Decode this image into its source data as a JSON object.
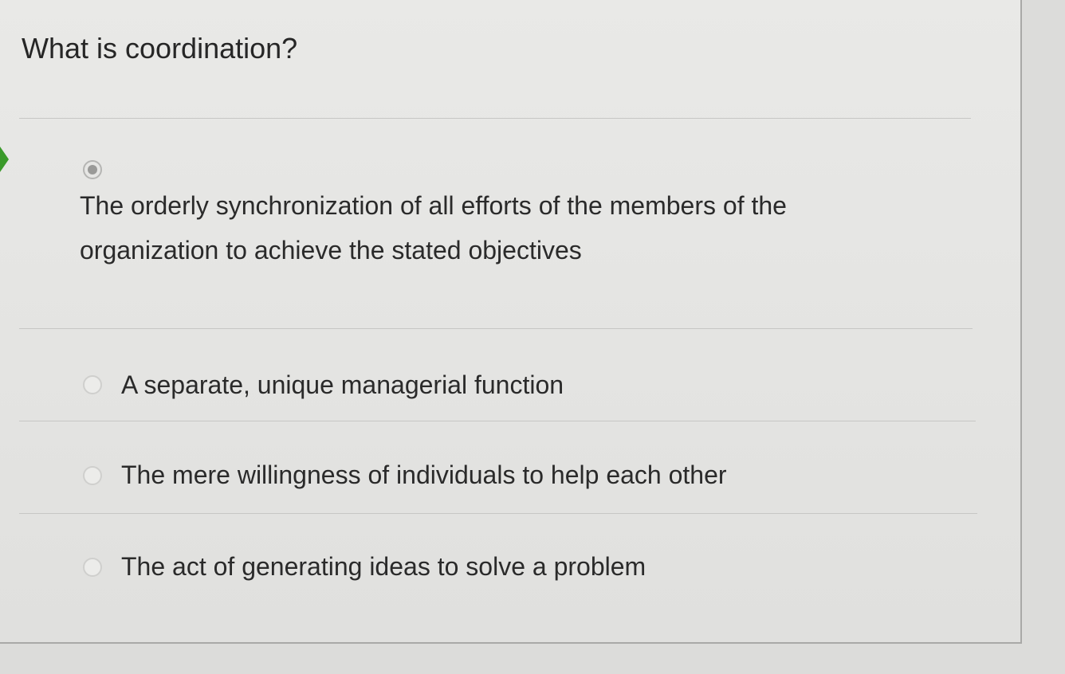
{
  "question": {
    "title": "What is coordination?"
  },
  "options": [
    {
      "label": "The orderly synchronization of all efforts of the members of the organization to achieve the stated objectives",
      "selected": true
    },
    {
      "label": "A separate, unique managerial function",
      "selected": false
    },
    {
      "label": "The mere willingness of individuals to help each other",
      "selected": false
    },
    {
      "label": "The act of generating ideas to solve a problem",
      "selected": false
    }
  ],
  "colors": {
    "selected_indicator": "#3a9a2a"
  }
}
